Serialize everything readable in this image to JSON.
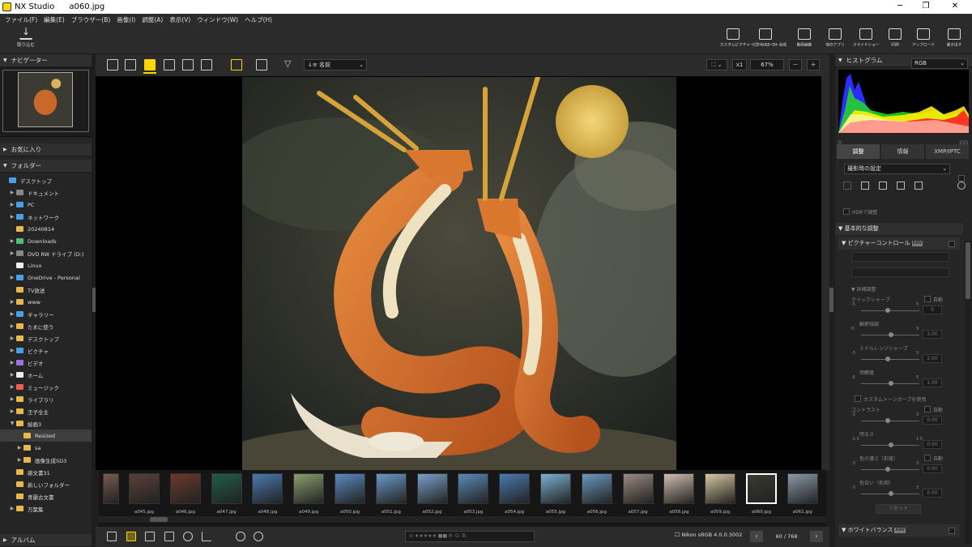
{
  "window": {
    "app_name": "NX Studio",
    "file_name": "a060.jpg"
  },
  "menu": [
    "ファイル(F)",
    "編集(E)",
    "ブラウザー(B)",
    "画像(I)",
    "調整(A)",
    "表示(V)",
    "ウィンドウ(W)",
    "ヘルプ(H)"
  ],
  "toolbar": {
    "import": "取り込む",
    "items": [
      "カスタムピクチャーコントロール",
      "ピクセルシフト合成",
      "動画編集",
      "他のアプリ",
      "スライドショー",
      "印刷",
      "アップロード",
      "書き出す"
    ]
  },
  "sidebar": {
    "navigator": "ナビゲーター",
    "favorites": "お気に入り",
    "folders": "フォルダー",
    "album": "アルバム",
    "tree": [
      {
        "label": "デスクトップ",
        "indent": 0,
        "arrow": "",
        "color": "blue"
      },
      {
        "label": "ドキュメント",
        "indent": 1,
        "arrow": "▶",
        "color": "gray"
      },
      {
        "label": "PC",
        "indent": 1,
        "arrow": "▶",
        "color": "blue"
      },
      {
        "label": "ネットワーク",
        "indent": 1,
        "arrow": "▶",
        "color": "blue"
      },
      {
        "label": "20240814",
        "indent": 1,
        "arrow": "",
        "color": "yellow"
      },
      {
        "label": "Downloads",
        "indent": 1,
        "arrow": "▶",
        "color": "green"
      },
      {
        "label": "DVD RW ドライブ (D:)",
        "indent": 1,
        "arrow": "▶",
        "color": "gray"
      },
      {
        "label": "Linux",
        "indent": 1,
        "arrow": "",
        "color": "white"
      },
      {
        "label": "OneDrive - Personal",
        "indent": 1,
        "arrow": "▶",
        "color": "blue"
      },
      {
        "label": "TV放送",
        "indent": 1,
        "arrow": "",
        "color": "yellow"
      },
      {
        "label": "www",
        "indent": 1,
        "arrow": "▶",
        "color": "yellow"
      },
      {
        "label": "ギャラリー",
        "indent": 1,
        "arrow": "▶",
        "color": "blue"
      },
      {
        "label": "たまに使う",
        "indent": 1,
        "arrow": "▶",
        "color": "yellow"
      },
      {
        "label": "デスクトップ",
        "indent": 1,
        "arrow": "▶",
        "color": "yellow"
      },
      {
        "label": "ピクチャ",
        "indent": 1,
        "arrow": "▶",
        "color": "blue"
      },
      {
        "label": "ビデオ",
        "indent": 1,
        "arrow": "▶",
        "color": "purple"
      },
      {
        "label": "ホーム",
        "indent": 1,
        "arrow": "▶",
        "color": "white"
      },
      {
        "label": "ミュージック",
        "indent": 1,
        "arrow": "▶",
        "color": "red"
      },
      {
        "label": "ライブラリ",
        "indent": 1,
        "arrow": "▶",
        "color": "yellow"
      },
      {
        "label": "王子全主",
        "indent": 1,
        "arrow": "▶",
        "color": "yellow"
      },
      {
        "label": "絵画3",
        "indent": 1,
        "arrow": "▼",
        "color": "yellow"
      },
      {
        "label": "Resized",
        "indent": 2,
        "arrow": "",
        "color": "yellow",
        "selected": true
      },
      {
        "label": "sa",
        "indent": 2,
        "arrow": "▶",
        "color": "yellow"
      },
      {
        "label": "画像生成SD3",
        "indent": 2,
        "arrow": "▶",
        "color": "yellow"
      },
      {
        "label": "雑文書31",
        "indent": 1,
        "arrow": "",
        "color": "yellow"
      },
      {
        "label": "新しいフォルダー",
        "indent": 1,
        "arrow": "",
        "color": "yellow"
      },
      {
        "label": "青蘭古文書",
        "indent": 1,
        "arrow": "",
        "color": "yellow"
      },
      {
        "label": "万葉集",
        "indent": 1,
        "arrow": "▶",
        "color": "yellow"
      }
    ]
  },
  "viewer": {
    "sort_label": "名前",
    "zoom_multiplier": "x1",
    "zoom_percent": "67%"
  },
  "filmstrip": [
    {
      "name": "",
      "bg": "#7a5a50"
    },
    {
      "name": "a045.jpg",
      "bg": "#5a4038"
    },
    {
      "name": "a046.jpg",
      "bg": "#6a3a2a"
    },
    {
      "name": "a047.jpg",
      "bg": "#1f5c4a"
    },
    {
      "name": "a048.jpg",
      "bg": "#4a7ab0"
    },
    {
      "name": "a049.jpg",
      "bg": "#8aa070"
    },
    {
      "name": "a050.jpg",
      "bg": "#5a8ac0"
    },
    {
      "name": "a051.jpg",
      "bg": "#6a9ac8"
    },
    {
      "name": "a052.jpg",
      "bg": "#7aa0c8"
    },
    {
      "name": "a053.jpg",
      "bg": "#5a8ab8"
    },
    {
      "name": "a054.jpg",
      "bg": "#4a7ab0"
    },
    {
      "name": "a055.jpg",
      "bg": "#7ab0d0"
    },
    {
      "name": "a056.jpg",
      "bg": "#6a9ac0"
    },
    {
      "name": "a057.jpg",
      "bg": "#9a8a80"
    },
    {
      "name": "a058.jpg",
      "bg": "#d0c0b0"
    },
    {
      "name": "a059.jpg",
      "bg": "#d8c8a0"
    },
    {
      "name": "a060.jpg",
      "bg": "#3a3a30",
      "selected": true
    },
    {
      "name": "a061.jpg",
      "bg": "#8a9aa8"
    }
  ],
  "bottombar": {
    "rating_text": "R:  G:  B:",
    "colorspace": "Nikon sRGB 4.0.0.3002",
    "page": "60 / 768"
  },
  "right_panel": {
    "histogram_label": "ヒストグラム",
    "histogram_channel": "RGB",
    "hist_min": "0",
    "hist_max": "255",
    "tabs": [
      "調整",
      "情報",
      "XMP/IPTC"
    ],
    "preset": "撮影時の設定",
    "hdr": "HDRで調整",
    "basic": "基本的な調整",
    "picture_control": "ピクチャーコントロール",
    "badge": "RAW",
    "detail": "詳細調整",
    "sliders": [
      {
        "label": "クイックシャープ",
        "value": "0",
        "auto": "自動",
        "min": "-5",
        "max": "5"
      },
      {
        "label": "輪郭強調",
        "value": "3.00",
        "min": "0",
        "max": "9"
      },
      {
        "label": "ミドルレンジシャープ",
        "value": "2.00",
        "min": "-5",
        "max": "5"
      },
      {
        "label": "明瞭度",
        "value": "1.00",
        "min": "-5",
        "max": "5"
      }
    ],
    "custom_curve": "カスタムトーンカーブを使用",
    "sliders2": [
      {
        "label": "コントラスト",
        "value": "0.00",
        "auto": "自動",
        "min": "-3",
        "max": "3"
      },
      {
        "label": "明るさ",
        "value": "0.00",
        "min": "-1.5",
        "max": "1.5"
      },
      {
        "label": "色の濃さ（彩度）",
        "value": "0.00",
        "auto": "自動",
        "min": "-3",
        "max": "3"
      },
      {
        "label": "色合い（色相）",
        "value": "0.00",
        "min": "-3",
        "max": "3"
      }
    ],
    "reset": "リセット",
    "white_balance": "ホワイトバランス"
  }
}
